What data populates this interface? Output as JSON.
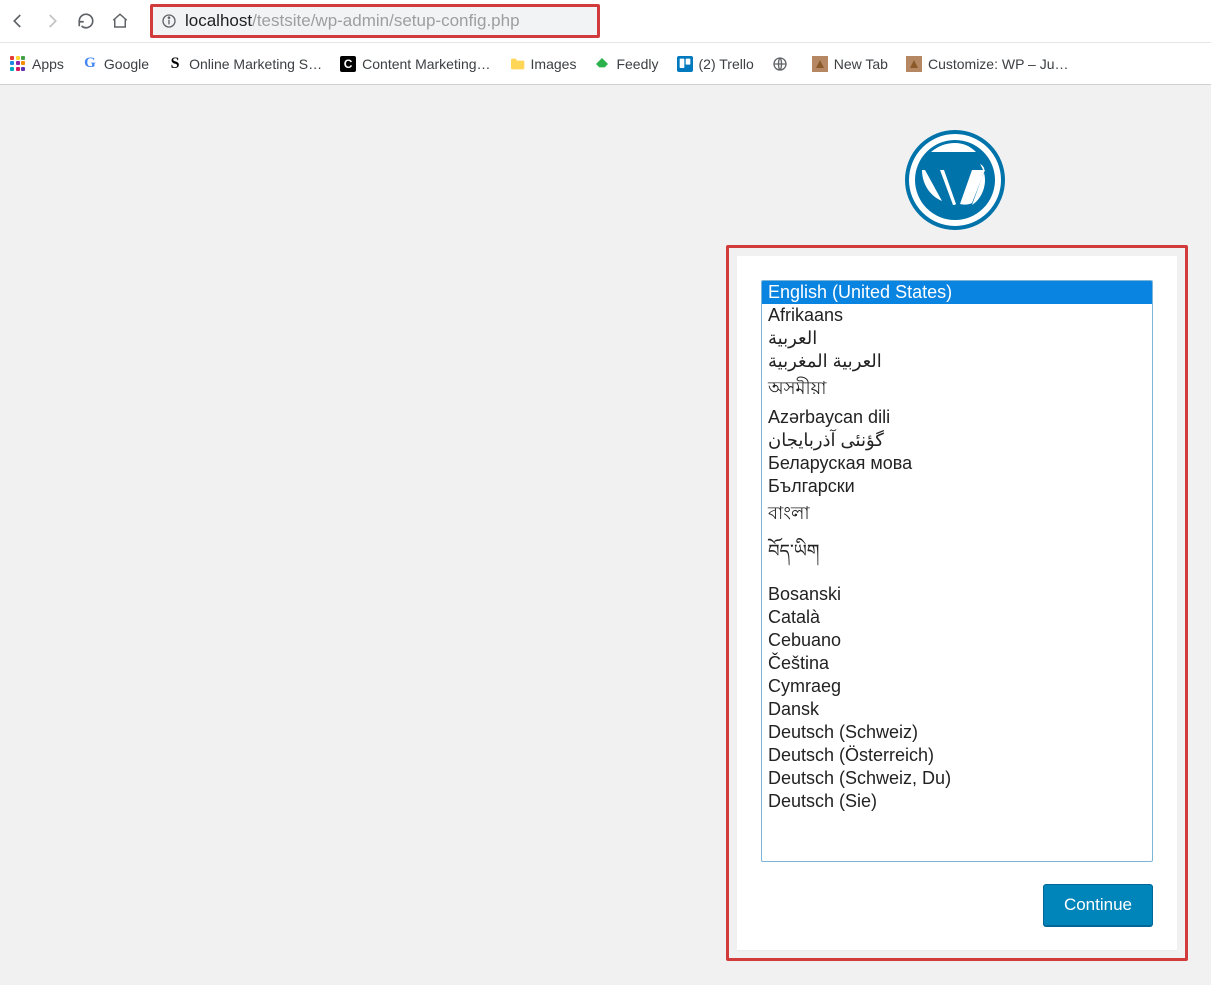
{
  "browser": {
    "url_host": "localhost",
    "url_path": "/testsite/wp-admin/setup-config.php"
  },
  "bookmarks": {
    "apps_label": "Apps",
    "items": [
      {
        "label": "Google"
      },
      {
        "label": "Online Marketing S…"
      },
      {
        "label": "Content Marketing…"
      },
      {
        "label": "Images"
      },
      {
        "label": "Feedly"
      },
      {
        "label": "(2) Trello"
      },
      {
        "label": ""
      },
      {
        "label": "New Tab"
      },
      {
        "label": "Customize: WP – Ju…"
      }
    ]
  },
  "setup": {
    "selected_index": 0,
    "continue_label": "Continue",
    "languages": [
      "English (United States)",
      "Afrikaans",
      "العربية",
      "العربية المغربية",
      "অসমীয়া",
      "Azərbaycan dili",
      "گؤنئی آذربایجان",
      "Беларуская мова",
      "Български",
      "বাংলা",
      "བོད་ཡིག",
      "Bosanski",
      "Català",
      "Cebuano",
      "Čeština",
      "Cymraeg",
      "Dansk",
      "Deutsch (Schweiz)",
      "Deutsch (Österreich)",
      "Deutsch (Schweiz, Du)",
      "Deutsch (Sie)"
    ]
  }
}
